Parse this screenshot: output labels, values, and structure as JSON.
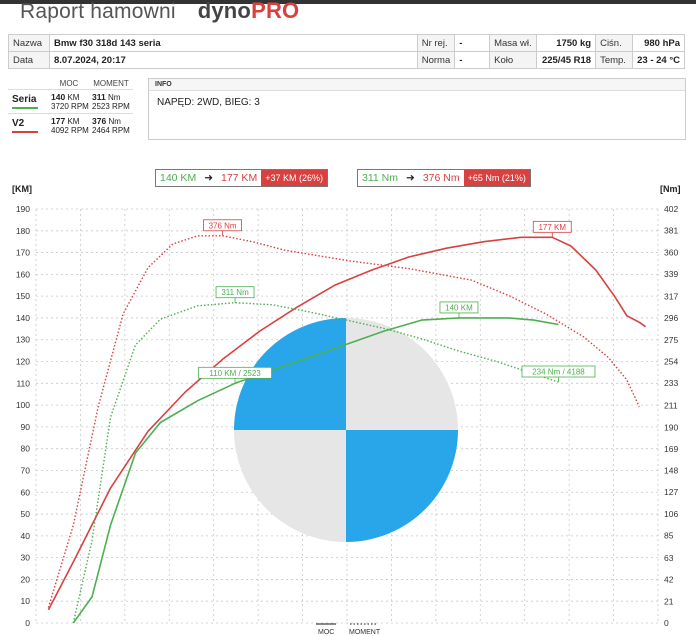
{
  "header": {
    "title": "Raport hamowni",
    "brand": "dyno",
    "brand_accent": "PRO"
  },
  "info_table": {
    "row1": [
      "Nazwa",
      "Bmw f30 318d 143 seria",
      "Nr rej.",
      "-",
      "Masa wł.",
      "1750 kg",
      "Ciśn.",
      "980 hPa"
    ],
    "row2": [
      "Data",
      "8.07.2024, 20:17",
      "Norma",
      "-",
      "Koło",
      "225/45 R18",
      "Temp.",
      "23 - 24 °C"
    ]
  },
  "runs": {
    "col_power": "MOC",
    "col_torque": "MOMENT",
    "items": [
      {
        "name": "Seria",
        "color": "#4caf50",
        "power": "140",
        "power_unit": "KM",
        "power_rpm": "3720 RPM",
        "torque": "311",
        "torque_unit": "Nm",
        "torque_rpm": "2523 RPM"
      },
      {
        "name": "V2",
        "color": "#d94040",
        "power": "177",
        "power_unit": "KM",
        "power_rpm": "4092 RPM",
        "torque": "376",
        "torque_unit": "Nm",
        "torque_rpm": "2464 RPM"
      }
    ]
  },
  "info_box": {
    "heading": "INFO",
    "text": "NAPĘD: 2WD,  BIEG: 3"
  },
  "summary": {
    "power_from": "140 KM",
    "power_to": "177 KM",
    "power_delta": "+37 KM  (26%)",
    "torque_from": "311 Nm",
    "torque_to": "376 Nm",
    "torque_delta": "+65 Nm  (21%)"
  },
  "colors": {
    "seria": "#4caf50",
    "v2": "#d94040",
    "logo_blue": "#1ea0e8",
    "logo_gray": "#e6e6e6"
  },
  "legend": {
    "power": "MOC",
    "torque": "MOMENT"
  },
  "chart_data": {
    "type": "line",
    "y_left_label": "[KM]",
    "y_right_label": "[Nm]",
    "y_left_ticks": [
      0,
      10,
      20,
      30,
      40,
      50,
      60,
      70,
      80,
      90,
      100,
      110,
      120,
      130,
      140,
      150,
      160,
      170,
      180,
      190
    ],
    "y_right_ticks": [
      0,
      21,
      42,
      63,
      85,
      106,
      127,
      148,
      169,
      190,
      211,
      233,
      254,
      275,
      296,
      317,
      339,
      360,
      381,
      402
    ],
    "ylim_left": [
      0,
      190
    ],
    "ylim_right": [
      0,
      402
    ],
    "grid": true,
    "xlim": [
      0,
      1
    ],
    "series": [
      {
        "name": "V2",
        "quantity": "MOC",
        "style": "solid",
        "color": "#d94040",
        "x": [
          0.02,
          0.06,
          0.12,
          0.18,
          0.24,
          0.3,
          0.36,
          0.42,
          0.48,
          0.54,
          0.6,
          0.66,
          0.72,
          0.78,
          0.83,
          0.86,
          0.9,
          0.93,
          0.95,
          0.97,
          0.98
        ],
        "y": [
          6,
          28,
          62,
          88,
          106,
          121,
          134,
          145,
          155,
          162,
          168,
          172,
          175,
          177,
          177,
          173,
          162,
          150,
          141,
          138,
          136
        ]
      },
      {
        "name": "V2",
        "quantity": "MOMENT",
        "style": "dotted",
        "color": "#d94040",
        "x": [
          0.02,
          0.06,
          0.1,
          0.14,
          0.18,
          0.22,
          0.26,
          0.3,
          0.35,
          0.4,
          0.5,
          0.6,
          0.7,
          0.76,
          0.82,
          0.88,
          0.92,
          0.95,
          0.97
        ],
        "y": [
          15,
          95,
          210,
          300,
          345,
          368,
          376,
          376,
          370,
          362,
          352,
          344,
          333,
          318,
          300,
          278,
          258,
          236,
          210
        ]
      },
      {
        "name": "Seria",
        "quantity": "MOC",
        "style": "solid",
        "color": "#4caf50",
        "x": [
          0.06,
          0.09,
          0.12,
          0.16,
          0.2,
          0.26,
          0.32,
          0.38,
          0.44,
          0.5,
          0.56,
          0.62,
          0.68,
          0.72,
          0.76,
          0.8,
          0.84
        ],
        "y": [
          0,
          12,
          45,
          78,
          92,
          102,
          110,
          116,
          122,
          128,
          134,
          139,
          140,
          140,
          140,
          139,
          137
        ]
      },
      {
        "name": "Seria",
        "quantity": "MOMENT",
        "style": "dotted",
        "color": "#4caf50",
        "x": [
          0.06,
          0.09,
          0.12,
          0.16,
          0.2,
          0.26,
          0.32,
          0.38,
          0.44,
          0.5,
          0.56,
          0.62,
          0.68,
          0.74,
          0.8,
          0.84
        ],
        "y": [
          0,
          80,
          200,
          270,
          295,
          308,
          311,
          309,
          302,
          294,
          286,
          276,
          264,
          254,
          242,
          234
        ]
      }
    ],
    "annotations": [
      {
        "text": "376 Nm",
        "series": "V2 MOMENT",
        "x": 0.3,
        "y_right": 376,
        "color": "#d94040"
      },
      {
        "text": "177 KM",
        "series": "V2 MOC",
        "x": 0.83,
        "y_left": 177,
        "color": "#d94040"
      },
      {
        "text": "311 Nm",
        "series": "Seria MOMENT",
        "x": 0.32,
        "y_right": 311,
        "color": "#4caf50"
      },
      {
        "text": "140 KM",
        "series": "Seria MOC",
        "x": 0.68,
        "y_left": 140,
        "color": "#4caf50"
      },
      {
        "text": "110 KM / 2523",
        "series": "Seria MOC",
        "x": 0.32,
        "y_left": 110,
        "color": "#4caf50"
      },
      {
        "text": "234 Nm / 4188",
        "series": "Seria MOMENT",
        "x": 0.84,
        "y_right": 234,
        "color": "#4caf50"
      }
    ]
  }
}
